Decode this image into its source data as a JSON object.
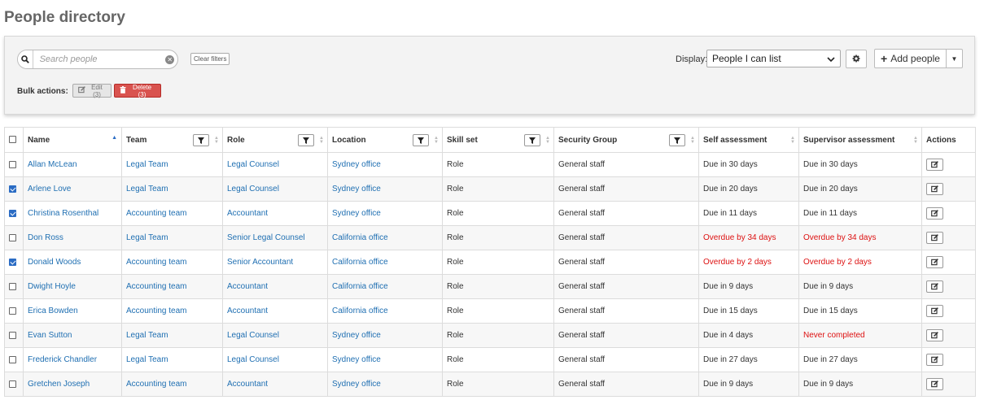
{
  "page": {
    "title": "People directory"
  },
  "filters": {
    "search_placeholder": "Search people",
    "clear_label": "Clear filters",
    "display_label": "Display:",
    "display_value": "People I can list",
    "add_people_label": "Add people"
  },
  "bulk": {
    "label": "Bulk actions:",
    "edit_label": "Edit (3)",
    "delete_label": "Delete (3)"
  },
  "colors": {
    "link": "#1f6fb2",
    "overdue": "#dd1111",
    "delete": "#d9534f",
    "checkbox": "#2b6cc4"
  },
  "table": {
    "headers": {
      "name": "Name",
      "team": "Team",
      "role": "Role",
      "location": "Location",
      "skill": "Skill set",
      "security": "Security Group",
      "self": "Self assessment",
      "supervisor": "Supervisor assessment",
      "actions": "Actions"
    },
    "sort_column": "name",
    "sort_direction": "ascending",
    "rows": [
      {
        "checked": false,
        "name": "Allan McLean",
        "team": "Legal Team",
        "role": "Legal Counsel",
        "location": "Sydney office",
        "skill": "Role",
        "security": "General staff",
        "self": "Due in 30 days",
        "self_overdue": false,
        "supervisor": "Due in 30 days",
        "supervisor_overdue": false
      },
      {
        "checked": true,
        "name": "Arlene Love",
        "team": "Legal Team",
        "role": "Legal Counsel",
        "location": "Sydney office",
        "skill": "Role",
        "security": "General staff",
        "self": "Due in 20 days",
        "self_overdue": false,
        "supervisor": "Due in 20 days",
        "supervisor_overdue": false
      },
      {
        "checked": true,
        "name": "Christina Rosenthal",
        "team": "Accounting team",
        "role": "Accountant",
        "location": "Sydney office",
        "skill": "Role",
        "security": "General staff",
        "self": "Due in 11 days",
        "self_overdue": false,
        "supervisor": "Due in 11 days",
        "supervisor_overdue": false
      },
      {
        "checked": false,
        "name": "Don Ross",
        "team": "Legal Team",
        "role": "Senior Legal Counsel",
        "location": "California office",
        "skill": "Role",
        "security": "General staff",
        "self": "Overdue by 34 days",
        "self_overdue": true,
        "supervisor": "Overdue by 34 days",
        "supervisor_overdue": true
      },
      {
        "checked": true,
        "name": "Donald Woods",
        "team": "Accounting team",
        "role": "Senior Accountant",
        "location": "California office",
        "skill": "Role",
        "security": "General staff",
        "self": "Overdue by 2 days",
        "self_overdue": true,
        "supervisor": "Overdue by 2 days",
        "supervisor_overdue": true
      },
      {
        "checked": false,
        "name": "Dwight Hoyle",
        "team": "Accounting team",
        "role": "Accountant",
        "location": "California office",
        "skill": "Role",
        "security": "General staff",
        "self": "Due in 9 days",
        "self_overdue": false,
        "supervisor": "Due in 9 days",
        "supervisor_overdue": false
      },
      {
        "checked": false,
        "name": "Erica Bowden",
        "team": "Accounting team",
        "role": "Accountant",
        "location": "California office",
        "skill": "Role",
        "security": "General staff",
        "self": "Due in 15 days",
        "self_overdue": false,
        "supervisor": "Due in 15 days",
        "supervisor_overdue": false
      },
      {
        "checked": false,
        "name": "Evan Sutton",
        "team": "Legal Team",
        "role": "Legal Counsel",
        "location": "Sydney office",
        "skill": "Role",
        "security": "General staff",
        "self": "Due in 4 days",
        "self_overdue": false,
        "supervisor": "Never completed",
        "supervisor_overdue": true
      },
      {
        "checked": false,
        "name": "Frederick Chandler",
        "team": "Legal Team",
        "role": "Legal Counsel",
        "location": "Sydney office",
        "skill": "Role",
        "security": "General staff",
        "self": "Due in 27 days",
        "self_overdue": false,
        "supervisor": "Due in 27 days",
        "supervisor_overdue": false
      },
      {
        "checked": false,
        "name": "Gretchen Joseph",
        "team": "Accounting team",
        "role": "Accountant",
        "location": "Sydney office",
        "skill": "Role",
        "security": "General staff",
        "self": "Due in 9 days",
        "self_overdue": false,
        "supervisor": "Due in 9 days",
        "supervisor_overdue": false
      }
    ]
  }
}
